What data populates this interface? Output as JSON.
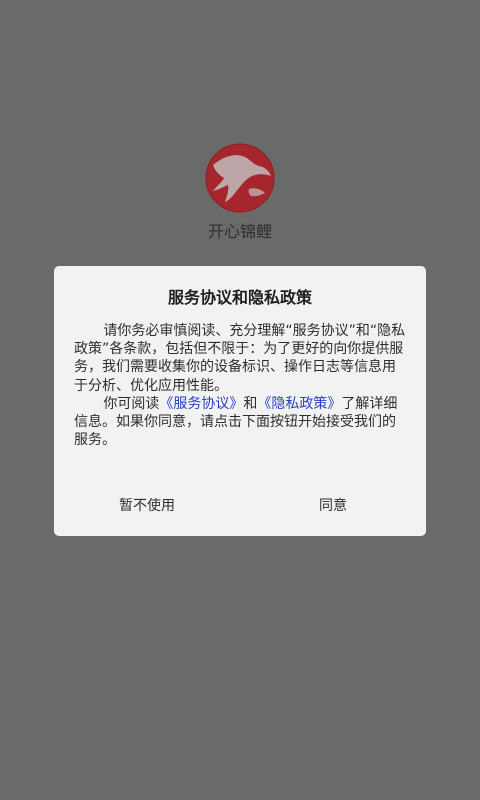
{
  "app": {
    "name": "开心锦鲤",
    "logo_icon": "koi-logo-icon"
  },
  "dialog": {
    "title": "服务协议和隐私政策",
    "paragraph1": "请你务必审慎阅读、充分理解“服务协议”和“隐私政策”各条款，包括但不限于：为了更好的向你提供服务，我们需要收集你的设备标识、操作日志等信息用于分析、优化应用性能。",
    "paragraph2": {
      "prefix": "你可阅读",
      "service_link": "《服务协议》",
      "middle": "和",
      "privacy_link": "《隐私政策》",
      "suffix": "了解详细信息。如果你同意，请点击下面按钮开始接受我们的服务。"
    },
    "decline_label": "暂不使用",
    "accept_label": "同意"
  },
  "colors": {
    "overlay": "#6a6a6a",
    "dialog_bg": "#f2f2f2",
    "link": "#2a3fc2",
    "logo_red": "#a5262c"
  }
}
